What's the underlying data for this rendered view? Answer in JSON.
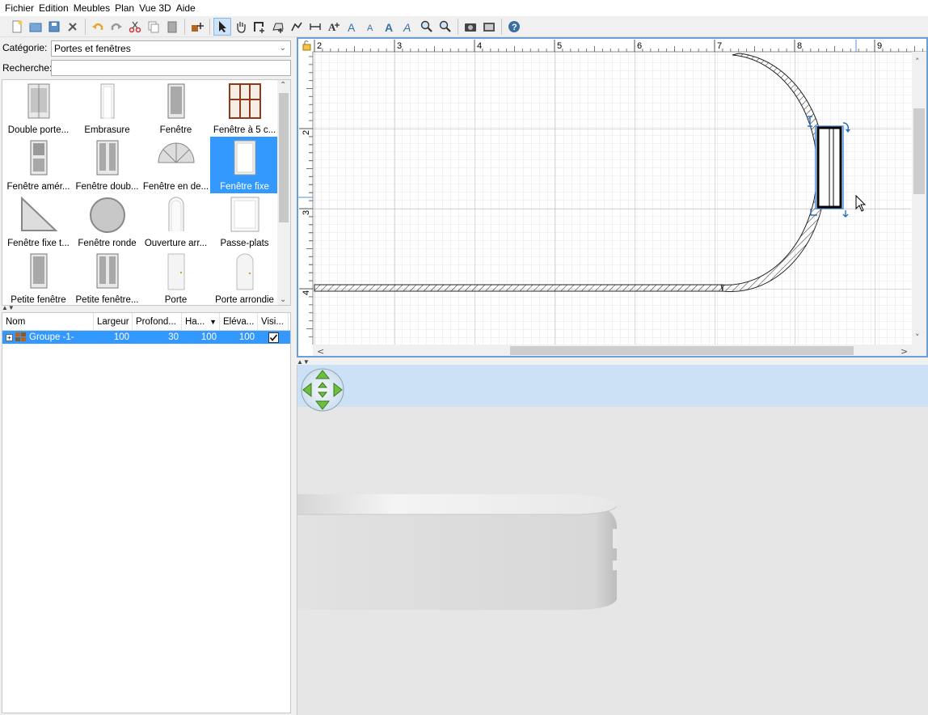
{
  "menu": [
    "Fichier",
    "Edition",
    "Meubles",
    "Plan",
    "Vue 3D",
    "Aide"
  ],
  "toolbar": {
    "icons": [
      "new-icon",
      "open-icon",
      "save-icon",
      "preferences-icon",
      "undo-icon",
      "redo-icon",
      "cut-icon",
      "copy-icon",
      "paste-icon",
      "add-furniture-icon",
      "select-icon",
      "pan-icon",
      "create-walls-icon",
      "create-rooms-icon",
      "create-polylines-icon",
      "create-dimensions-icon",
      "add-text-icon",
      "increase-text-icon",
      "decrease-text-icon",
      "bold-text-icon",
      "italic-text-icon",
      "zoom-in-icon",
      "zoom-out-icon",
      "create-photo-icon",
      "create-video-icon",
      "help-icon"
    ]
  },
  "catalog": {
    "category_label": "Catégorie:",
    "category_value": "Portes et fenêtres",
    "search_label": "Recherche:",
    "search_value": "",
    "items": [
      {
        "label": "Double porte...",
        "icon": "double-door-icon"
      },
      {
        "label": "Embrasure",
        "icon": "doorway-icon"
      },
      {
        "label": "Fenêtre",
        "icon": "window-icon"
      },
      {
        "label": "Fenêtre à 5 c...",
        "icon": "five-pane-window-icon"
      },
      {
        "label": "Fenêtre amér...",
        "icon": "american-window-icon"
      },
      {
        "label": "Fenêtre doub...",
        "icon": "double-window-icon"
      },
      {
        "label": "Fenêtre en de...",
        "icon": "half-round-window-icon"
      },
      {
        "label": "Fenêtre fixe",
        "icon": "fixed-window-icon",
        "selected": true
      },
      {
        "label": "Fenêtre fixe t...",
        "icon": "triangle-window-icon"
      },
      {
        "label": "Fenêtre ronde",
        "icon": "round-window-icon"
      },
      {
        "label": "Ouverture arr...",
        "icon": "arched-opening-icon"
      },
      {
        "label": "Passe-plats",
        "icon": "service-hatch-icon"
      },
      {
        "label": "Petite fenêtre",
        "icon": "small-window-icon"
      },
      {
        "label": "Petite fenêtre...",
        "icon": "small-double-window-icon"
      },
      {
        "label": "Porte",
        "icon": "door-icon"
      },
      {
        "label": "Porte arrondie",
        "icon": "round-door-icon"
      }
    ]
  },
  "furniture_table": {
    "headers": [
      "Nom",
      "Largeur",
      "Profond...",
      "Ha...",
      "Eléva...",
      "Visi..."
    ],
    "rows": [
      {
        "name": "Groupe -1-",
        "width": "100",
        "depth": "30",
        "height": "100",
        "elevation": "100",
        "visible": true
      }
    ]
  },
  "plan": {
    "ruler_x": [
      "2",
      "3",
      "4",
      "5",
      "6",
      "7",
      "8",
      "9"
    ],
    "ruler_y": [
      "2",
      "3",
      "4"
    ]
  }
}
